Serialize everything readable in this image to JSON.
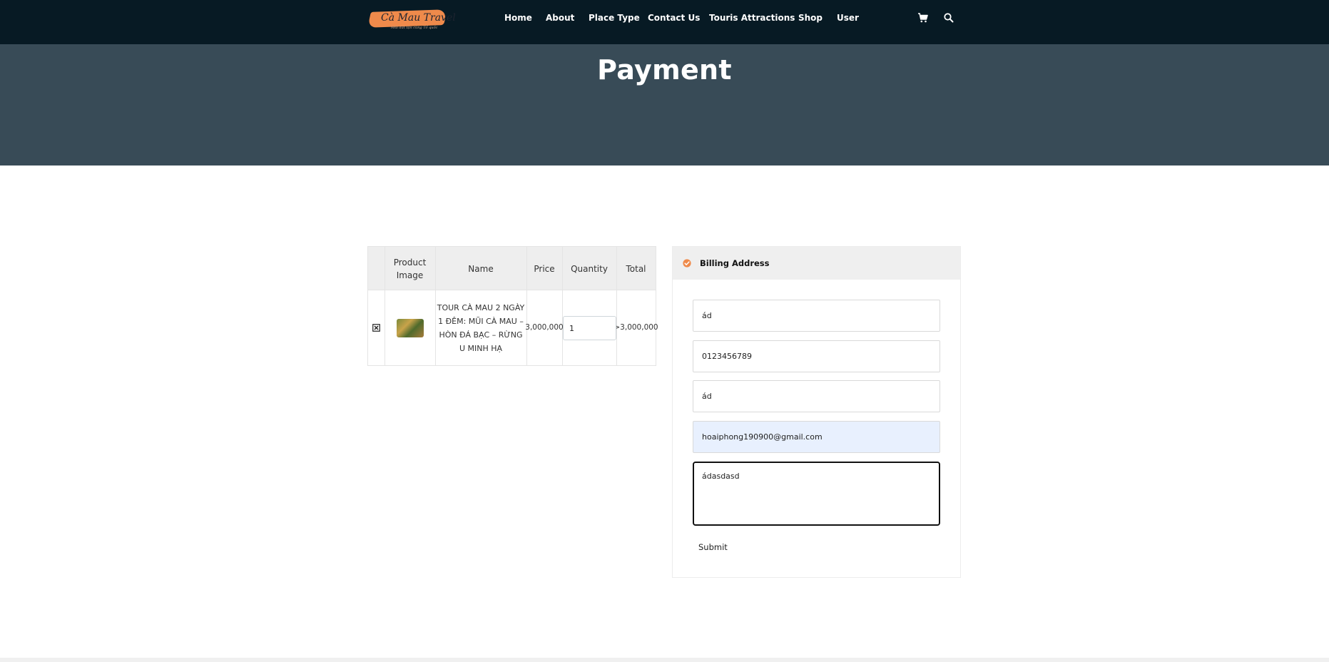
{
  "brand": {
    "logo_text": "Cà Mau Travel",
    "logo_tagline": "Mũi đất tận cùng Tổ quốc",
    "accent_color": "#ef8a4b"
  },
  "nav": {
    "items": [
      {
        "label": "Home"
      },
      {
        "label": "About"
      },
      {
        "label": "Place Type"
      },
      {
        "label": "Contact Us"
      },
      {
        "label": "Touris Attractions"
      },
      {
        "label": "Shop"
      },
      {
        "label": "User"
      }
    ],
    "icons": [
      "cart-icon",
      "search-icon"
    ],
    "bg_color": "#071a24"
  },
  "hero": {
    "title": "Payment",
    "bg_color": "#384b57"
  },
  "cart": {
    "columns": [
      "",
      "Product Image",
      "Name",
      "Price",
      "Quantity",
      "Total"
    ],
    "rows": [
      {
        "remove_icon": "close-box-icon",
        "image_icon": "tour-thumbnail",
        "name": "TOUR CÀ MAU 2 NGÀY 1 ĐÊM: MŨI CÀ MAU – HÒN ĐÁ BẠC – RỪNG U MINH HẠ",
        "price": "3,000,000",
        "quantity": "1",
        "total": ">3,000,000"
      }
    ]
  },
  "billing": {
    "title": "Billing Address",
    "check_icon": "check-circle-icon",
    "fields": [
      {
        "name": "name",
        "value": "ád"
      },
      {
        "name": "phone",
        "value": "0123456789"
      },
      {
        "name": "address",
        "value": "ád"
      },
      {
        "name": "email",
        "value": "hoaiphong190900@gmail.com"
      }
    ],
    "note": "ádasdasd",
    "submit_label": "Submit"
  }
}
